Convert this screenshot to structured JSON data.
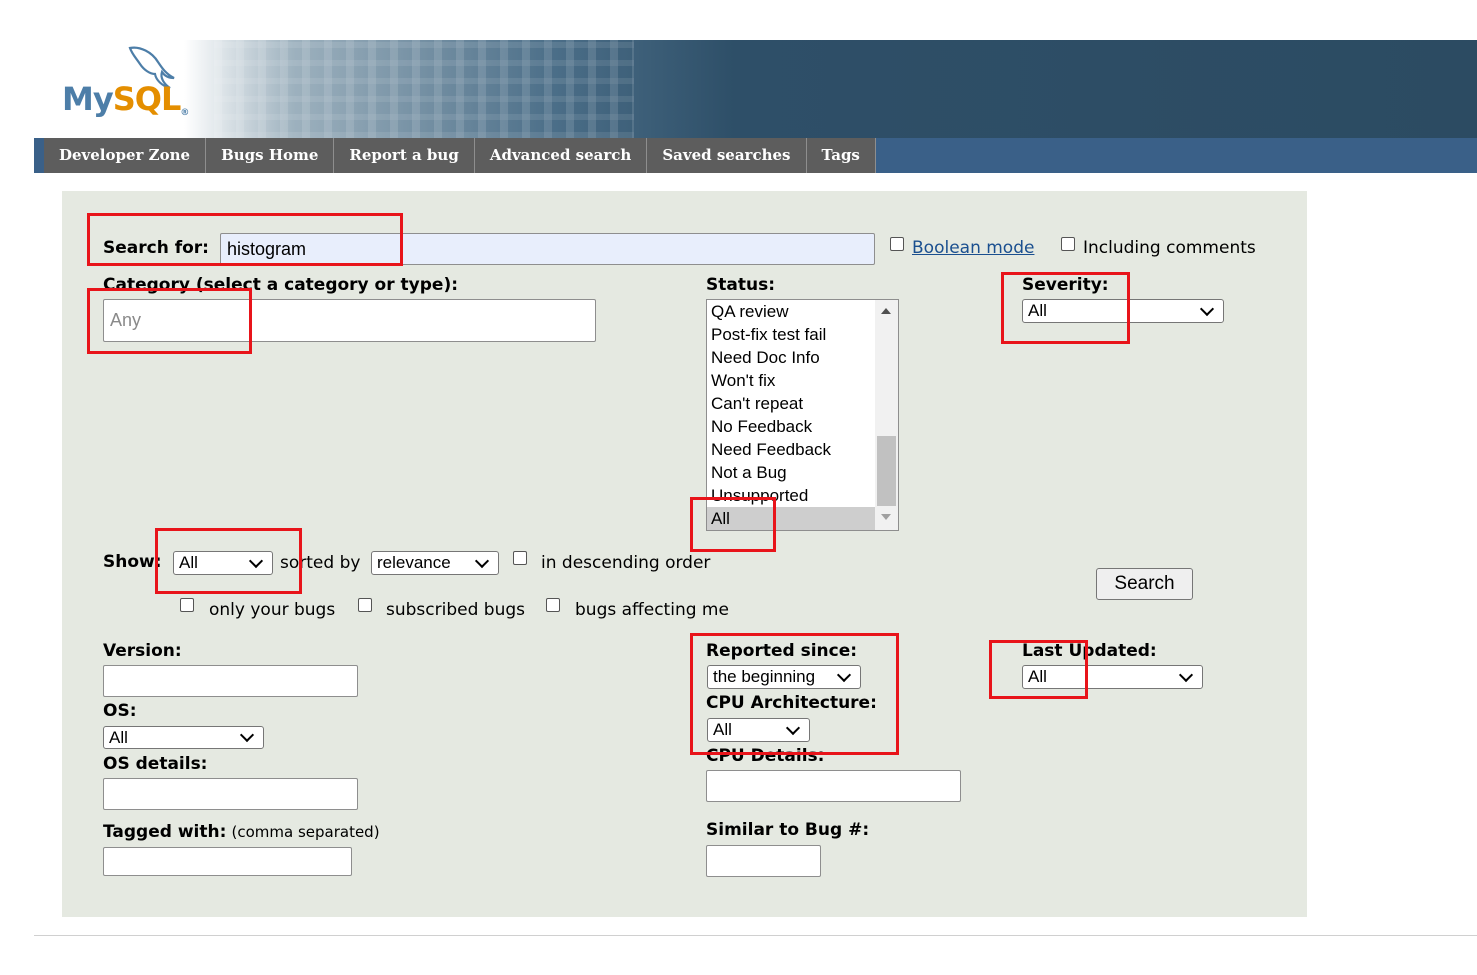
{
  "logo": {
    "text_my": "My",
    "text_sql": "SQL",
    "trademark": "®",
    "icon": "mysql-dolphin-logo"
  },
  "nav": [
    {
      "label": "Developer Zone"
    },
    {
      "label": "Bugs Home"
    },
    {
      "label": "Report a bug"
    },
    {
      "label": "Advanced search"
    },
    {
      "label": "Saved searches"
    },
    {
      "label": "Tags"
    }
  ],
  "search": {
    "label": "Search for:",
    "value": "histogram",
    "boolean_mode": "Boolean mode",
    "including_comments": "Including comments"
  },
  "category": {
    "label": "Category (select a category or type):",
    "placeholder": "Any"
  },
  "status": {
    "label": "Status:",
    "options": [
      "QA review",
      "Post-fix test fail",
      "Need Doc Info",
      "Won't fix",
      "Can't repeat",
      "No Feedback",
      "Need Feedback",
      "Not a Bug",
      "Unsupported",
      "All"
    ],
    "selected": "All"
  },
  "severity": {
    "label": "Severity:",
    "value": "All"
  },
  "show": {
    "label": "Show:",
    "value": "All",
    "sorted_by_label": "sorted by",
    "sort_value": "relevance",
    "descending_label": "in descending order",
    "only_your_bugs": "only your bugs",
    "subscribed_bugs": "subscribed bugs",
    "bugs_affecting_me": "bugs affecting me"
  },
  "search_button": "Search",
  "version": {
    "label": "Version:",
    "value": ""
  },
  "os": {
    "label": "OS:",
    "value": "All"
  },
  "os_details": {
    "label": "OS details:",
    "value": ""
  },
  "tagged_with": {
    "label": "Tagged with:",
    "hint": "(comma separated)",
    "value": ""
  },
  "reported_since": {
    "label": "Reported since:",
    "value": "the beginning"
  },
  "cpu_architecture": {
    "label": "CPU Architecture:",
    "value": "All"
  },
  "cpu_details": {
    "label": "CPU Details:",
    "value": ""
  },
  "similar_to_bug": {
    "label": "Similar to Bug #:",
    "value": ""
  },
  "last_updated": {
    "label": "Last Updated:",
    "value": "All"
  },
  "annotation_color": "#e8141a"
}
